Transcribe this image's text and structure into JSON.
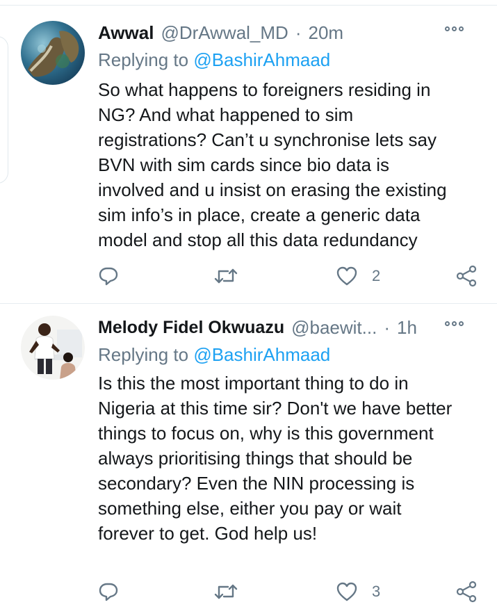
{
  "colors": {
    "accent": "#1da1f2",
    "secondary_text": "#657786",
    "primary_text": "#14171a",
    "divider": "#e6ecf0"
  },
  "tweets": [
    {
      "name": "Awwal",
      "handle": "@DrAwwal_MD",
      "separator": "·",
      "time": "20m",
      "replying_prefix": "Replying to",
      "replying_to": "@BashirAhmaad",
      "body_lines": [
        "So what happens to foreigners residing in",
        "NG? And what happened to sim",
        "registrations? Can’t u synchronise lets say",
        "BVN with sim cards since bio data is",
        "involved and u insist on erasing the existing",
        "sim info’s in place, create a generic data",
        "model and stop all this data redundancy"
      ],
      "likes": "2",
      "icons": [
        "reply-icon",
        "retweet-icon",
        "heart-icon",
        "share-icon",
        "more-icon"
      ]
    },
    {
      "name": "Melody Fidel Okwuazu",
      "handle": "@baewit...",
      "separator": "·",
      "time": "1h",
      "replying_prefix": "Replying to",
      "replying_to": "@BashirAhmaad",
      "body_lines": [
        "Is this the most important thing to do in",
        "Nigeria at this time sir? Don't we have better",
        "things to focus on, why is this government",
        "always prioritising things that should be",
        "secondary? Even the NIN processing is",
        "something else, either you pay or wait",
        "forever to get. God help us!"
      ],
      "likes": "3",
      "icons": [
        "reply-icon",
        "retweet-icon",
        "heart-icon",
        "share-icon",
        "more-icon"
      ]
    }
  ]
}
